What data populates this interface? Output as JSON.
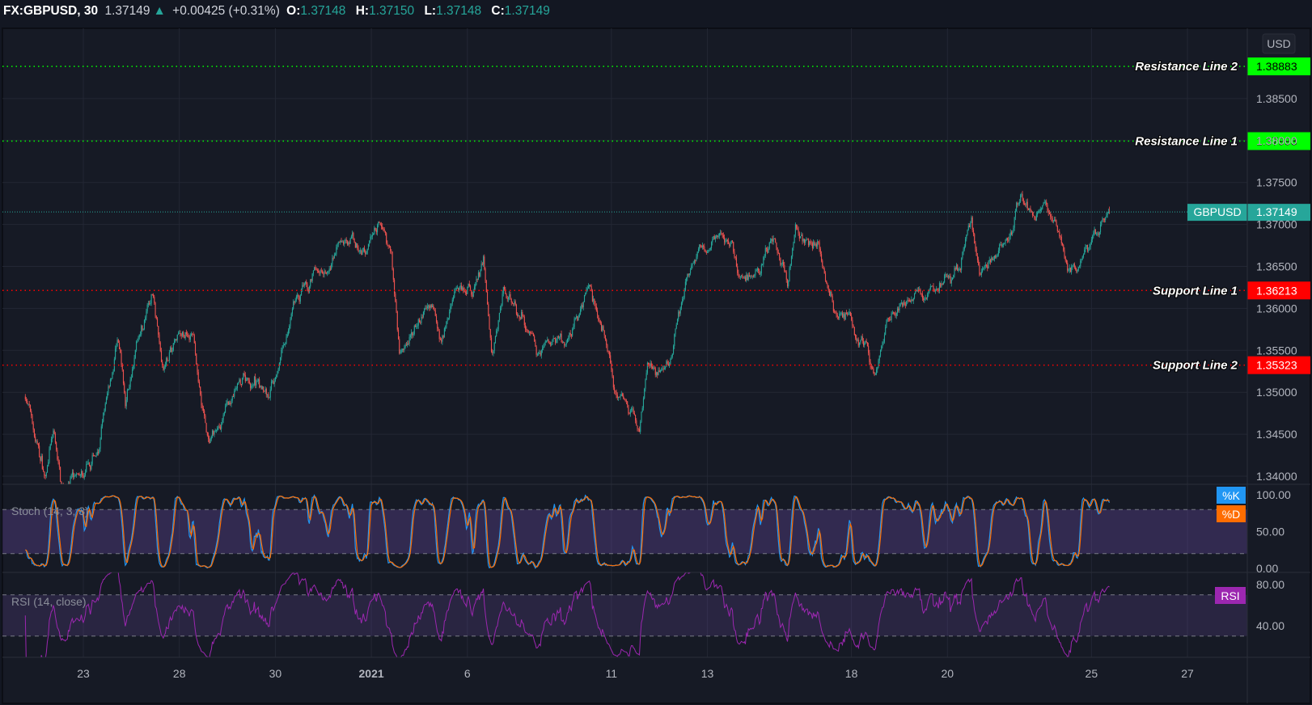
{
  "header": {
    "symbol": "FX:GBPUSD, 30",
    "last": "1.37149",
    "arrow": "▲",
    "change": "+0.00425 (+0.31%)",
    "o_label": "O:",
    "o": "1.37148",
    "h_label": "H:",
    "h": "1.37150",
    "l_label": "L:",
    "l": "1.37148",
    "c_label": "C:",
    "c": "1.37149"
  },
  "chart_data": {
    "type": "candlestick",
    "currency": "USD",
    "interval_minutes": 30,
    "ylim": [
      1.3385,
      1.3915
    ],
    "price_ticks": [
      "1.38500",
      "1.38000",
      "1.37500",
      "1.37000",
      "1.36500",
      "1.36000",
      "1.35500",
      "1.35000",
      "1.34500",
      "1.34000"
    ],
    "time_ticks": [
      {
        "label": "23",
        "date": "2020-12-23"
      },
      {
        "label": "28",
        "date": "2020-12-28"
      },
      {
        "label": "30",
        "date": "2020-12-30"
      },
      {
        "label": "2021",
        "date": "2021-01-01"
      },
      {
        "label": "6",
        "date": "2021-01-06"
      },
      {
        "label": "11",
        "date": "2021-01-11"
      },
      {
        "label": "13",
        "date": "2021-01-13"
      },
      {
        "label": "18",
        "date": "2021-01-18"
      },
      {
        "label": "20",
        "date": "2021-01-20"
      },
      {
        "label": "25",
        "date": "2021-01-25"
      },
      {
        "label": "27",
        "date": "2021-01-27"
      }
    ],
    "levels": [
      {
        "name": "Resistance Line 2",
        "value": "1.38883",
        "color": "#00ff00",
        "text_color": "#000000"
      },
      {
        "name": "Resistance Line 1",
        "value": "1.37993",
        "color": "#00ff00",
        "text_color": "#000000"
      },
      {
        "name": "Support Line 1",
        "value": "1.36213",
        "color": "#ff0000",
        "text_color": "#ffffff"
      },
      {
        "name": "Support Line 2",
        "value": "1.35323",
        "color": "#ff0000",
        "text_color": "#ffffff"
      }
    ],
    "current": {
      "symbol": "GBPUSD",
      "value": "1.37149",
      "color": "#26a69a"
    },
    "price_path": [
      [
        "2020-12-21 19:00",
        1.3495
      ],
      [
        "2020-12-21 23:00",
        1.3456
      ],
      [
        "2020-12-22 05:00",
        1.34
      ],
      [
        "2020-12-22 09:00",
        1.3446
      ],
      [
        "2020-12-22 13:00",
        1.3392
      ],
      [
        "2020-12-23 00:00",
        1.3397
      ],
      [
        "2020-12-23 08:00",
        1.3436
      ],
      [
        "2020-12-23 17:00",
        1.3563
      ],
      [
        "2020-12-23 21:00",
        1.3485
      ],
      [
        "2020-12-24 03:00",
        1.3563
      ],
      [
        "2020-12-24 11:00",
        1.3617
      ],
      [
        "2020-12-24 16:00",
        1.3534
      ],
      [
        "2020-12-28 00:00",
        1.3573
      ],
      [
        "2020-12-28 07:00",
        1.3563
      ],
      [
        "2020-12-28 11:00",
        1.3485
      ],
      [
        "2020-12-28 15:00",
        1.3436
      ],
      [
        "2020-12-28 21:00",
        1.3466
      ],
      [
        "2020-12-29 08:00",
        1.3514
      ],
      [
        "2020-12-29 21:00",
        1.3505
      ],
      [
        "2020-12-30 03:00",
        1.3544
      ],
      [
        "2020-12-30 09:00",
        1.3602
      ],
      [
        "2020-12-31 00:00",
        1.3642
      ],
      [
        "2020-12-31 11:00",
        1.3681
      ],
      [
        "2020-12-31 19:00",
        1.3671
      ],
      [
        "2021-01-04 06:00",
        1.37
      ],
      [
        "2021-01-04 10:00",
        1.3671
      ],
      [
        "2021-01-04 14:00",
        1.3554
      ],
      [
        "2021-01-04 22:00",
        1.3573
      ],
      [
        "2021-01-05 07:00",
        1.3602
      ],
      [
        "2021-01-05 11:00",
        1.3563
      ],
      [
        "2021-01-05 17:00",
        1.3632
      ],
      [
        "2021-01-06 02:00",
        1.3612
      ],
      [
        "2021-01-06 08:00",
        1.3661
      ],
      [
        "2021-01-06 12:00",
        1.3544
      ],
      [
        "2021-01-06 18:00",
        1.3622
      ],
      [
        "2021-01-07 03:00",
        1.3593
      ],
      [
        "2021-01-07 11:00",
        1.3554
      ],
      [
        "2021-01-07 20:00",
        1.3563
      ],
      [
        "2021-01-08 04:00",
        1.3568
      ],
      [
        "2021-01-08 13:00",
        1.3622
      ],
      [
        "2021-01-08 19:00",
        1.3573
      ],
      [
        "2021-01-11 01:00",
        1.3514
      ],
      [
        "2021-01-11 14:00",
        1.3456
      ],
      [
        "2021-01-11 18:00",
        1.3534
      ],
      [
        "2021-01-12 03:00",
        1.3524
      ],
      [
        "2021-01-12 11:00",
        1.3602
      ],
      [
        "2021-01-12 19:00",
        1.3671
      ],
      [
        "2021-01-13 04:00",
        1.369
      ],
      [
        "2021-01-13 12:00",
        1.3671
      ],
      [
        "2021-01-13 16:00",
        1.3632
      ],
      [
        "2021-01-14 01:00",
        1.3642
      ],
      [
        "2021-01-14 09:00",
        1.3681
      ],
      [
        "2021-01-14 16:00",
        1.3632
      ],
      [
        "2021-01-14 20:00",
        1.369
      ],
      [
        "2021-01-15 02:00",
        1.3681
      ],
      [
        "2021-01-15 08:00",
        1.3671
      ],
      [
        "2021-01-15 15:00",
        1.3602
      ],
      [
        "2021-01-15 23:00",
        1.3583
      ],
      [
        "2021-01-18 08:00",
        1.3554
      ],
      [
        "2021-01-18 12:00",
        1.3524
      ],
      [
        "2021-01-18 18:00",
        1.3583
      ],
      [
        "2021-01-19 05:00",
        1.3602
      ],
      [
        "2021-01-19 17:00",
        1.3622
      ],
      [
        "2021-01-20 06:00",
        1.3651
      ],
      [
        "2021-01-20 12:00",
        1.371
      ],
      [
        "2021-01-20 16:00",
        1.3642
      ],
      [
        "2021-01-20 23:00",
        1.3661
      ],
      [
        "2021-01-21 07:00",
        1.369
      ],
      [
        "2021-01-21 13:00",
        1.3735
      ],
      [
        "2021-01-21 20:00",
        1.371
      ],
      [
        "2021-01-22 00:00",
        1.373
      ],
      [
        "2021-01-22 06:00",
        1.3705
      ],
      [
        "2021-01-22 13:00",
        1.3651
      ],
      [
        "2021-01-22 17:00",
        1.3651
      ],
      [
        "2021-01-22 21:00",
        1.3681
      ],
      [
        "2021-01-25 03:00",
        1.369
      ],
      [
        "2021-01-25 09:00",
        1.37149
      ]
    ],
    "colors": {
      "up": "#26a69a",
      "down": "#ef5350",
      "k": "#2196f3",
      "d": "#ff6d00",
      "rsi": "#9c27b0",
      "band_fill": "#7e57c2"
    },
    "stoch": {
      "title": "Stoch (14, 3, 3)",
      "k_label": "%K",
      "d_label": "%D",
      "ticks": [
        "100.00",
        "50.00",
        "0.00"
      ],
      "bands": [
        20,
        80
      ]
    },
    "rsi": {
      "title": "RSI (14, close)",
      "label": "RSI",
      "ticks": [
        "80.00",
        "40.00"
      ],
      "bands": [
        30,
        70
      ]
    }
  }
}
